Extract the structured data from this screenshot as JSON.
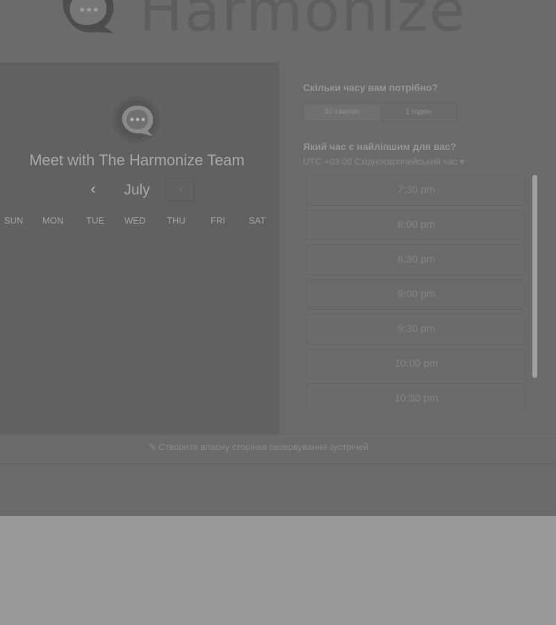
{
  "brand": {
    "name": "Harmonize",
    "logo_icon": "chat-bubble-icon"
  },
  "calendar": {
    "title": "Meet with The Harmonize Team",
    "avatar_icon": "chat-bubble-icon",
    "month": "July",
    "prev_glyph": "‹",
    "next_glyph": "›",
    "weekdays": [
      "SUN",
      "MON",
      "TUE",
      "WED",
      "THU",
      "FRI",
      "SAT"
    ]
  },
  "booking": {
    "duration_question": "Скільки часу вам потрібно?",
    "durations": [
      {
        "label": "30 хвилин",
        "selected": true
      },
      {
        "label": "1 годин",
        "selected": false
      }
    ],
    "time_question": "Який час є найліпшим для вас?",
    "timezone": "UTC +03:00 Східноєвропейський час ▾",
    "slots": [
      "7:30 pm",
      "8:00 pm",
      "8:30 pm",
      "9:00 pm",
      "9:30 pm",
      "10:00 pm",
      "10:30 pm"
    ]
  },
  "footer": {
    "link_icon": "sprocket-icon",
    "link_glyph": "✎",
    "link_text": "Створити власну сторінка резервування зустрічей"
  }
}
